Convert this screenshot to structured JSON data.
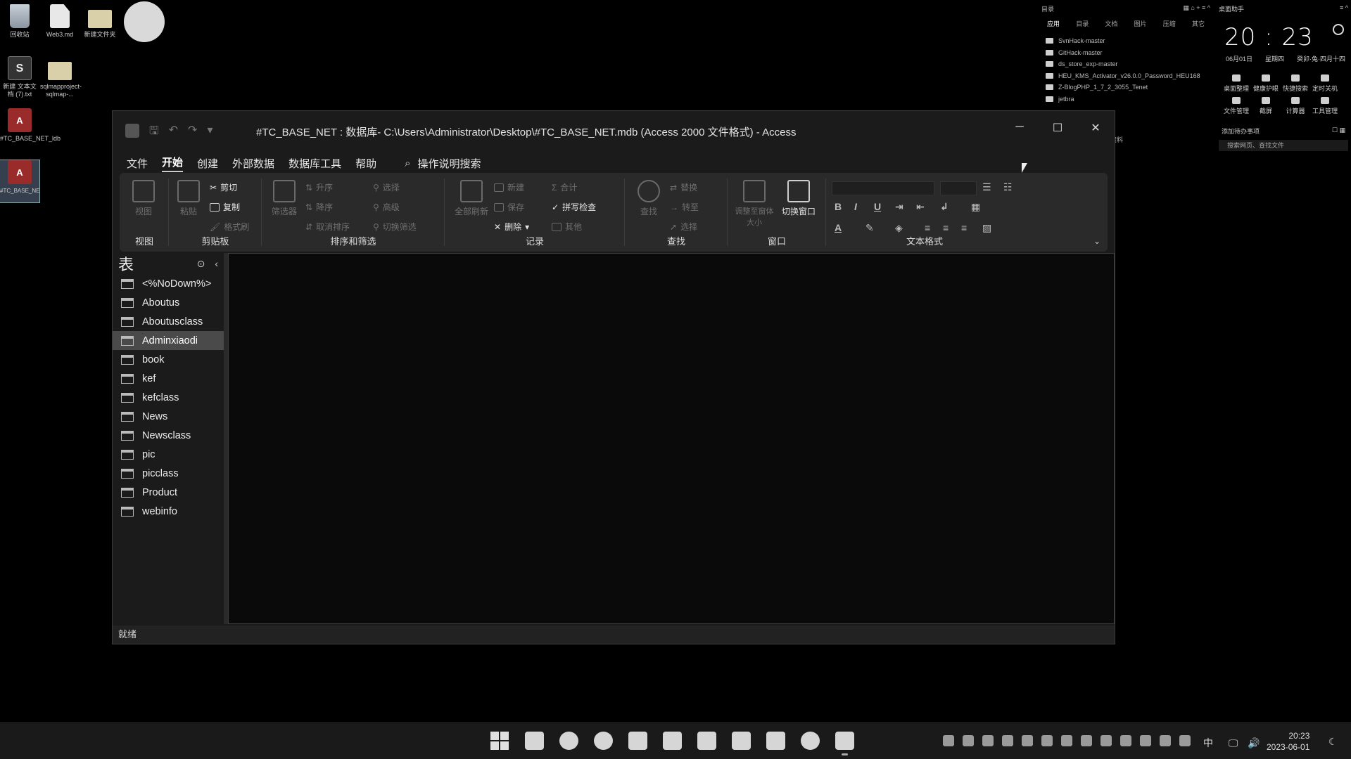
{
  "desktop": {
    "icons": [
      {
        "label": "回收站"
      },
      {
        "label": "Web3.md"
      },
      {
        "label": "新建文件夹"
      },
      {
        "label": "新建 文本文档 (7).txt"
      },
      {
        "label": "sqlmapproject-sqlmap-..."
      },
      {
        "label": "#TC_BASE_NET_ldb"
      },
      {
        "label": "#TC_BASE_NET.mdb"
      }
    ]
  },
  "files_widget": {
    "title": "目录",
    "tabs": [
      "应用",
      "目录",
      "文档",
      "图片",
      "压缩",
      "其它"
    ],
    "items": [
      "SvnHack-master",
      "GitHack-master",
      "ds_store_exp-master",
      "HEU_KMS_Activator_v26.0.0_Password_HEU168",
      "Z-BlogPHP_1_7_2_3055_Tenet",
      "jetbra"
    ],
    "footer": "资料"
  },
  "clock_widget": {
    "title": "桌面助手",
    "time": "20 : 23",
    "date": "06月01日",
    "weekday": "星期四",
    "lunar": "癸卯·兔·四月十四",
    "tools": [
      "桌面整理",
      "健康护眼",
      "快捷搜索",
      "定时关机",
      "文件管理",
      "截屏",
      "计算器",
      "工具管理"
    ],
    "todo": "添加待办事项",
    "search_placeholder": "搜索网页、查找文件"
  },
  "window": {
    "title": "#TC_BASE_NET : 数据库- C:\\Users\\Administrator\\Desktop\\#TC_BASE_NET.mdb (Access 2000 文件格式)  -  Access",
    "buttons": {
      "minimize": "─",
      "maximize": "☐",
      "close": "✕"
    },
    "menu": [
      "文件",
      "开始",
      "创建",
      "外部数据",
      "数据库工具",
      "帮助"
    ],
    "active_menu": "开始",
    "search_label": "操作说明搜索",
    "ribbon": {
      "groups": {
        "view": "视图",
        "clipboard": "剪贴板",
        "sort_filter": "排序和筛选",
        "records": "记录",
        "find": "查找",
        "window": "窗口",
        "text_format": "文本格式"
      },
      "buttons": {
        "view": "视图",
        "paste": "粘贴",
        "cut": "剪切",
        "copy": "复制",
        "format_painter": "格式刷",
        "filter": "筛选器",
        "ascending": "升序",
        "descending": "降序",
        "remove_sort": "取消排序",
        "selection": "选择",
        "advanced": "高级",
        "toggle_filter": "切换筛选",
        "refresh_all": "全部刷新",
        "new": "新建",
        "save": "保存",
        "delete": "删除",
        "totals": "合计",
        "spelling": "拼写检查",
        "more": "其他",
        "find": "查找",
        "replace": "替换",
        "goto": "转至",
        "select": "选择",
        "fit_window": "调整至窗体大小",
        "switch_window": "切换窗口"
      }
    },
    "nav_pane": {
      "title": "表",
      "tables": [
        "<%NoDown%>",
        "Aboutus",
        "Aboutusclass",
        "Adminxiaodi",
        "book",
        "kef",
        "kefclass",
        "News",
        "Newsclass",
        "pic",
        "picclass",
        "Product",
        "webinfo"
      ],
      "selected": "Adminxiaodi"
    },
    "status": "就绪"
  },
  "taskbar": {
    "ime": "中",
    "time": "20:23",
    "date": "2023-06-01"
  }
}
